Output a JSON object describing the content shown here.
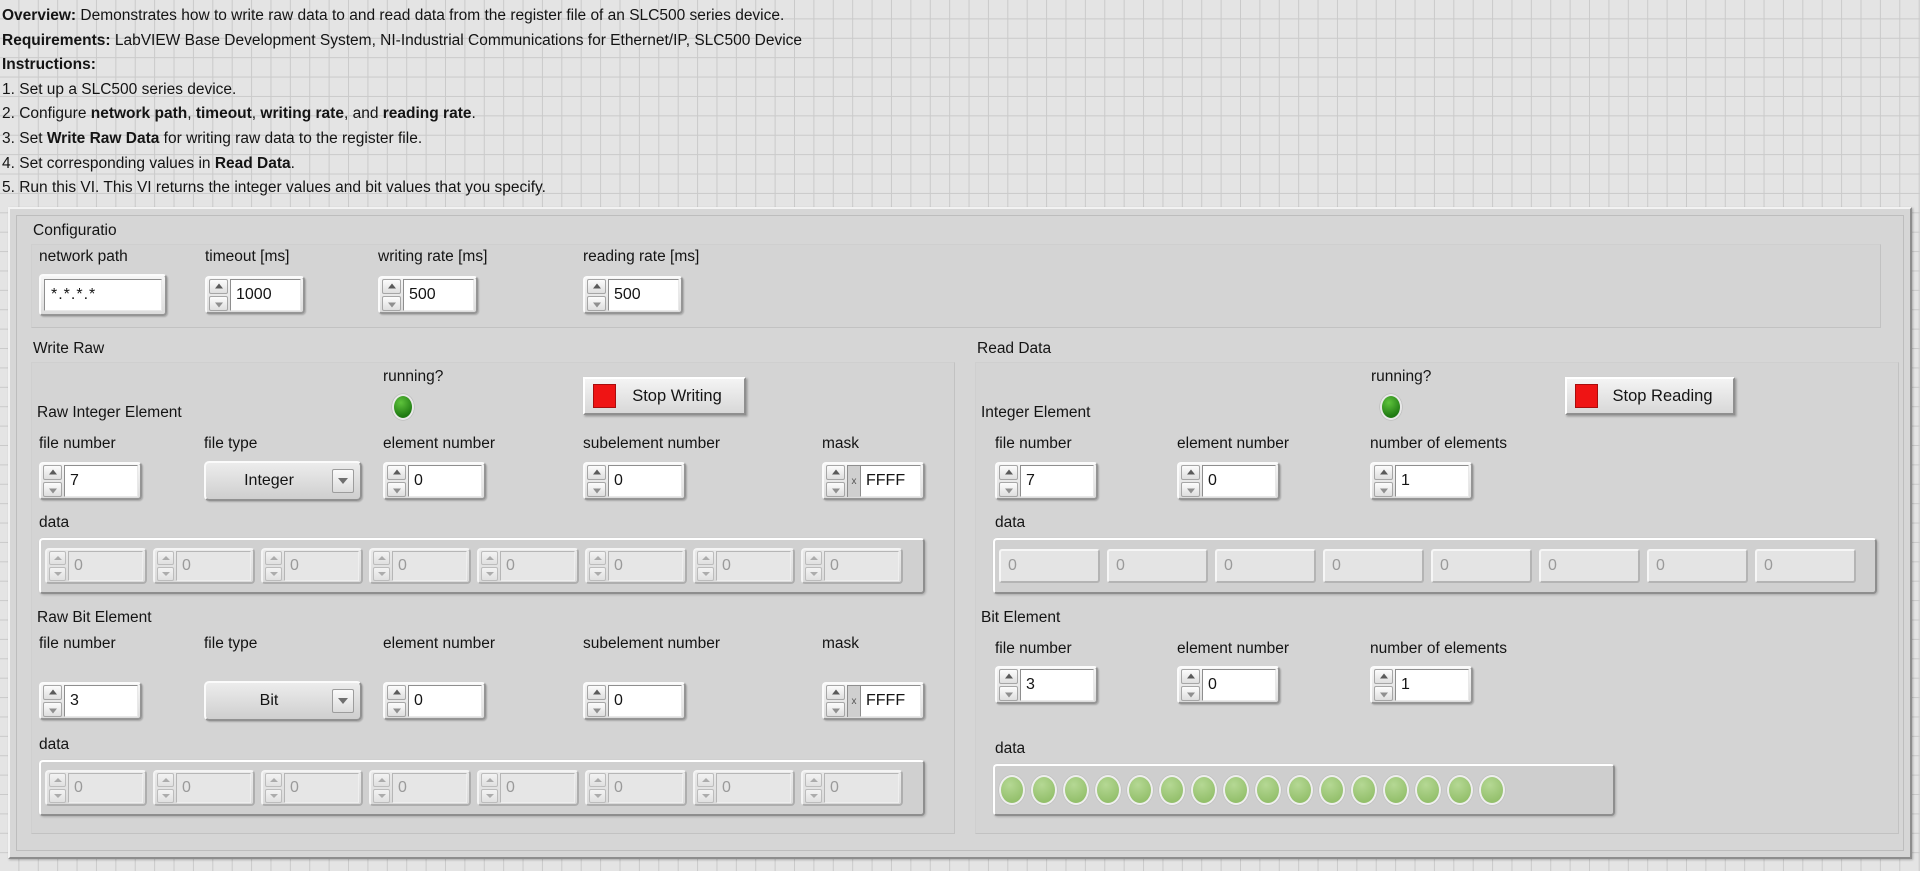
{
  "doc": {
    "lines": [
      {
        "bold": "Overview:",
        "rest": " Demonstrates how to write raw data to and read data from the register file of an SLC500 series device."
      },
      {
        "bold": "Requirements:",
        "rest": " LabVIEW Base Development System, NI-Industrial Communications for Ethernet/IP, SLC500 Device"
      },
      {
        "bold": "Instructions:",
        "rest": ""
      },
      {
        "bold": "",
        "rest": "1. Set up a SLC500 series device."
      },
      {
        "bold": "",
        "rest": "2. Configure network path, timeout, writing rate, and reading rate."
      },
      {
        "bold": "",
        "rest": "3. Set Write Raw Data for writing raw data to the register file."
      },
      {
        "bold": "",
        "rest": "4. Set corresponding values in Read Data."
      },
      {
        "bold": "",
        "rest": "5. Run this VI. This VI returns the integer values and bit values that you specify."
      }
    ],
    "line1_bold": "Overview:",
    "line1_rest": " Demonstrates how to write raw data to and read data from the register file of an SLC500 series device.",
    "line2_bold": "Requirements:",
    "line2_rest": " LabVIEW Base Development System, NI-Industrial Communications for Ethernet/IP, SLC500 Device",
    "line3_bold": "Instructions:",
    "line4": "1. Set up a SLC500 series device.",
    "line5_a": "2. Configure ",
    "line5_b1": "network path",
    "line5_c": ", ",
    "line5_b2": "timeout",
    "line5_d": ", ",
    "line5_b3": "writing rate",
    "line5_e": ", and ",
    "line5_b4": "reading rate",
    "line5_f": ".",
    "line6_a": "3. Set ",
    "line6_b": "Write Raw Data",
    "line6_c": " for writing raw data to the register file.",
    "line7_a": "4. Set corresponding values in ",
    "line7_b": "Read Data",
    "line7_c": ".",
    "line8": "5. Run this VI. This VI returns the integer values and bit values that you specify."
  },
  "configuration": {
    "title": "Configuratio",
    "network_path": {
      "label": "network path",
      "value": "*.*.*.*"
    },
    "timeout": {
      "label": "timeout [ms]",
      "value": "1000"
    },
    "writing_rate": {
      "label": "writing rate [ms]",
      "value": "500"
    },
    "reading_rate": {
      "label": "reading rate [ms]",
      "value": "500"
    }
  },
  "write_raw": {
    "title": "Write Raw",
    "running_label": "running?",
    "running_led": "on",
    "stop_button": "Stop Writing",
    "integer_element": {
      "title": "Raw Integer Element",
      "file_number": {
        "label": "file number",
        "value": "7"
      },
      "file_type": {
        "label": "file type",
        "value": "Integer"
      },
      "element_number": {
        "label": "element number",
        "value": "0"
      },
      "subelement_number": {
        "label": "subelement number",
        "value": "0"
      },
      "mask": {
        "label": "mask",
        "radix": "x",
        "value": "FFFF"
      },
      "data_label": "data",
      "data": [
        "0",
        "0",
        "0",
        "0",
        "0",
        "0",
        "0",
        "0"
      ]
    },
    "bit_element": {
      "title": "Raw Bit Element",
      "file_number": {
        "label": "file number",
        "value": "3"
      },
      "file_type": {
        "label": "file type",
        "value": "Bit"
      },
      "element_number": {
        "label": "element number",
        "value": "0"
      },
      "subelement_number": {
        "label": "subelement number",
        "value": "0"
      },
      "mask": {
        "label": "mask",
        "radix": "x",
        "value": "FFFF"
      },
      "data_label": "data",
      "data": [
        "0",
        "0",
        "0",
        "0",
        "0",
        "0",
        "0",
        "0"
      ]
    }
  },
  "read_data": {
    "title": "Read Data",
    "running_label": "running?",
    "running_led": "on",
    "stop_button": "Stop Reading",
    "integer_element": {
      "title": "Integer Element",
      "file_number": {
        "label": "file number",
        "value": "7"
      },
      "element_number": {
        "label": "element number",
        "value": "0"
      },
      "number_of_elements": {
        "label": "number of elements",
        "value": "1"
      },
      "data_label": "data",
      "data": [
        "0",
        "0",
        "0",
        "0",
        "0",
        "0",
        "0",
        "0"
      ]
    },
    "bit_element": {
      "title": "Bit Element",
      "file_number": {
        "label": "file number",
        "value": "3"
      },
      "element_number": {
        "label": "element number",
        "value": "0"
      },
      "number_of_elements": {
        "label": "number of elements",
        "value": "1"
      },
      "data_label": "data",
      "bits": [
        false,
        false,
        false,
        false,
        false,
        false,
        false,
        false,
        false,
        false,
        false,
        false,
        false,
        false,
        false,
        false
      ]
    }
  },
  "colors": {
    "panel_bg": "#d6d6d6",
    "frame_bg": "#d4d4d4",
    "led_on": "#2e9e1c",
    "led_off_green": "#a8cd80",
    "stop_red": "#ef1414",
    "grid_line": "#cacaca",
    "text": "#141414",
    "disabled_text": "#9a9a9a"
  }
}
